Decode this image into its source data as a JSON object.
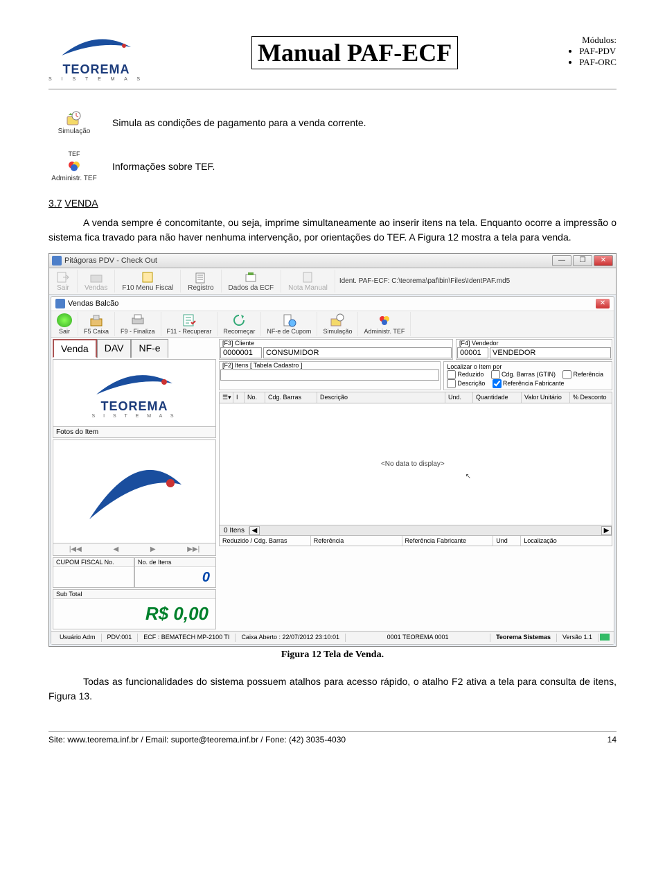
{
  "header": {
    "title": "Manual PAF-ECF",
    "logo_text": "TEOREMA",
    "logo_sub": "S I S T E M A S",
    "modules_label": "Módulos:",
    "modules": [
      "PAF-PDV",
      "PAF-ORC"
    ]
  },
  "icon1": {
    "label": "Simulação",
    "desc": "Simula as condições de pagamento para a venda corrente."
  },
  "icon2": {
    "top": "TEF",
    "label": "Administr. TEF",
    "desc": "Informações sobre TEF."
  },
  "section": {
    "num": "3.7",
    "title": "VENDA"
  },
  "para1": "A venda sempre é concomitante, ou seja, imprime simultaneamente ao inserir itens na tela. Enquanto ocorre a impressão o sistema fica travado para não haver nenhuma intervenção, por orientações do TEF. A Figura 12 mostra a tela para venda.",
  "screenshot": {
    "win_title": "Pitágoras PDV - Check Out",
    "menu1": {
      "m1": "Sair",
      "m2": "Vendas",
      "m3": "F10 Menu Fiscal",
      "m4": "Registro",
      "m5": "Dados da ECF",
      "m6": "Nota Manual",
      "ident": "Ident. PAF-ECF: C:\\teorema\\paf\\bin\\Files\\IdentPAF.md5"
    },
    "sub_title": "Vendas Balcão",
    "toolbar2": {
      "t1": "Sair",
      "t2": "F5 Caixa",
      "t3": "F9 - Finaliza",
      "t4": "F11 - Recuperar",
      "t5": "Recomeçar",
      "t6": "NF-e de Cupom",
      "t7": "Simulação",
      "t8": "Administr. TEF"
    },
    "tabs": {
      "tab1": "Venda",
      "tab2": "DAV",
      "tab3": "NF-e"
    },
    "cliente": {
      "label": "[F3] Cliente",
      "code": "0000001",
      "name": "CONSUMIDOR"
    },
    "vendedor": {
      "label": "[F4] Vendedor",
      "code": "00001",
      "name": "VENDEDOR"
    },
    "itens_label": "[F2] Itens [ Tabela Cadastro ]",
    "locate": {
      "title": "Localizar o Item por",
      "c1": "Reduzido",
      "c2": "Cdg. Barras (GTIN)",
      "c3": "Referência",
      "c4": "Descrição",
      "c5": "Referência Fabricante"
    },
    "cols": {
      "c0": "I",
      "c1": "No.",
      "c2": "Cdg. Barras",
      "c3": "Descrição",
      "c4": "Und.",
      "c5": "Quantidade",
      "c6": "Valor Unitário",
      "c7": "% Desconto"
    },
    "logo_text": "TEOREMA",
    "logo_sub": "S I S T E M A S",
    "fotos_label": "Fotos do Item",
    "nav": {
      "n1": "⤒",
      "n2": "◀",
      "n3": "▶",
      "n4": "⤓"
    },
    "cupom_label": "CUPOM FISCAL No.",
    "itens_no_label": "No. de Itens",
    "itens_no_val": "0",
    "subtotal_label": "Sub Total",
    "subtotal_val": "R$ 0,00",
    "no_data": "<No data to display>",
    "itens_count": "0 Itens",
    "foot": {
      "f1": "Reduzido / Cdg. Barras",
      "f2": "Referência",
      "f3": "Referência Fabricante",
      "f4": "Und",
      "f5": "Localização"
    },
    "status": {
      "s1": "Usuário Adm",
      "s2": "PDV:001",
      "s3": "ECF : BEMATECH MP-2100 TI",
      "s4": "Caixa Aberto : 22/07/2012 23:10:01",
      "s5": "0001 TEOREMA 0001",
      "s6": "Teorema Sistemas",
      "s7": "Versão 1.1"
    }
  },
  "caption": "Figura 12 Tela de Venda.",
  "para2": "Todas as funcionalidades do sistema possuem atalhos para acesso rápido, o atalho F2 ativa a tela para consulta de itens, Figura 13.",
  "footer": {
    "left": "Site: www.teorema.inf.br / Email: suporte@teorema.inf.br / Fone: (42) 3035-4030",
    "right": "14"
  }
}
